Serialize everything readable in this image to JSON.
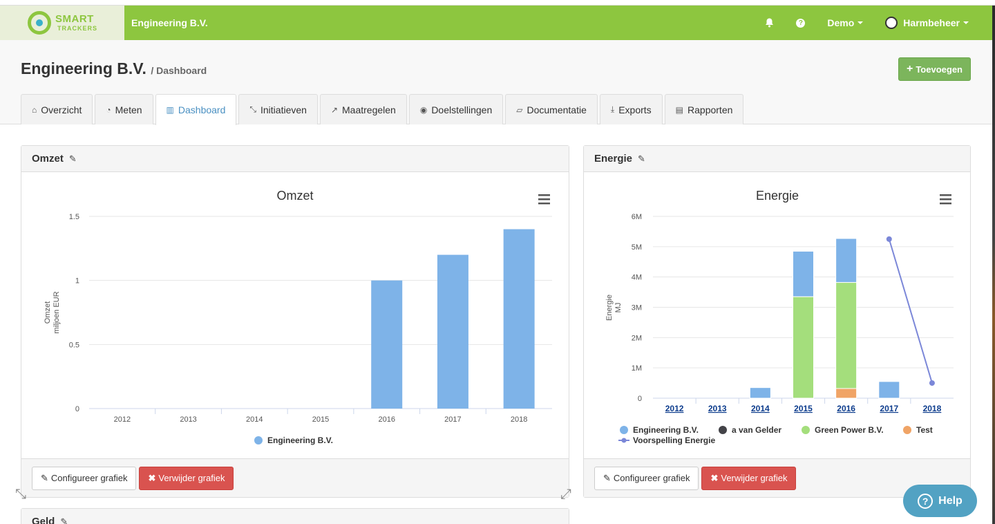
{
  "navbar": {
    "logo_line1": "SMART",
    "logo_line2": "TRACKERS",
    "company": "Engineering B.V.",
    "demo": "Demo",
    "user": "Harmbeheer"
  },
  "header": {
    "title": "Engineering B.V.",
    "subtitle": "/ Dashboard",
    "add_label": "Toevoegen"
  },
  "tabs": [
    {
      "label": "Overzicht",
      "icon": "home-icon"
    },
    {
      "label": "Meten",
      "icon": "dashboard-icon"
    },
    {
      "label": "Dashboard",
      "icon": "bar-chart-icon"
    },
    {
      "label": "Initiatieven",
      "icon": "compress-icon"
    },
    {
      "label": "Maatregelen",
      "icon": "arrow-icon"
    },
    {
      "label": "Doelstellingen",
      "icon": "target-icon"
    },
    {
      "label": "Documentatie",
      "icon": "folder-open-icon"
    },
    {
      "label": "Exports",
      "icon": "download-icon"
    },
    {
      "label": "Rapporten",
      "icon": "file-icon"
    }
  ],
  "panels": {
    "omzet": {
      "title": "Omzet",
      "configure": "Configureer grafiek",
      "delete": "Verwijder grafiek"
    },
    "energie": {
      "title": "Energie",
      "configure": "Configureer grafiek",
      "delete": "Verwijder grafiek"
    },
    "geld": {
      "title": "Geld"
    }
  },
  "help_label": "Help",
  "colors": {
    "brand": "#8dc63f",
    "bar_blue": "#7eb3e8",
    "green": "#a4de7c",
    "orange": "#f0a466",
    "dark": "#434348",
    "line": "#7b87d8",
    "danger": "#d9534f"
  },
  "chart_data": [
    {
      "type": "bar",
      "title": "Omzet",
      "ylabel": "Omzet",
      "ylabel2": "miljoen EUR",
      "categories": [
        "2012",
        "2013",
        "2014",
        "2015",
        "2016",
        "2017",
        "2018"
      ],
      "series": [
        {
          "name": "Engineering B.V.",
          "values": [
            0,
            0,
            0,
            0,
            1.0,
            1.2,
            1.4
          ]
        }
      ],
      "ylim": [
        0,
        1.5
      ],
      "yticks": [
        "0",
        "0.5",
        "1",
        "1.5"
      ],
      "legend": "bottom-center",
      "grid": true
    },
    {
      "type": "bar",
      "stacked": true,
      "title": "Energie",
      "ylabel": "Energie",
      "ylabel2": "MJ",
      "categories": [
        "2012",
        "2013",
        "2014",
        "2015",
        "2016",
        "2017",
        "2018"
      ],
      "series": [
        {
          "name": "Engineering B.V.",
          "values": [
            0,
            0,
            0.35,
            1.5,
            1.45,
            0.55,
            0
          ]
        },
        {
          "name": "a van Gelder",
          "values": [
            0,
            0,
            0,
            0,
            0,
            0,
            0
          ]
        },
        {
          "name": "Green Power B.V.",
          "values": [
            0,
            0,
            0,
            3.35,
            3.5,
            0,
            0
          ]
        },
        {
          "name": "Test",
          "values": [
            0,
            0,
            0,
            0,
            0.32,
            0,
            0
          ]
        }
      ],
      "line_series": {
        "name": "Voorspelling Energie",
        "points": [
          {
            "x": "2017",
            "y": 5.25
          },
          {
            "x": "2018",
            "y": 0.5
          }
        ]
      },
      "ylim": [
        0,
        6
      ],
      "yticks": [
        "0",
        "1M",
        "2M",
        "3M",
        "4M",
        "5M",
        "6M"
      ],
      "legend": "bottom-center",
      "grid": true
    }
  ]
}
